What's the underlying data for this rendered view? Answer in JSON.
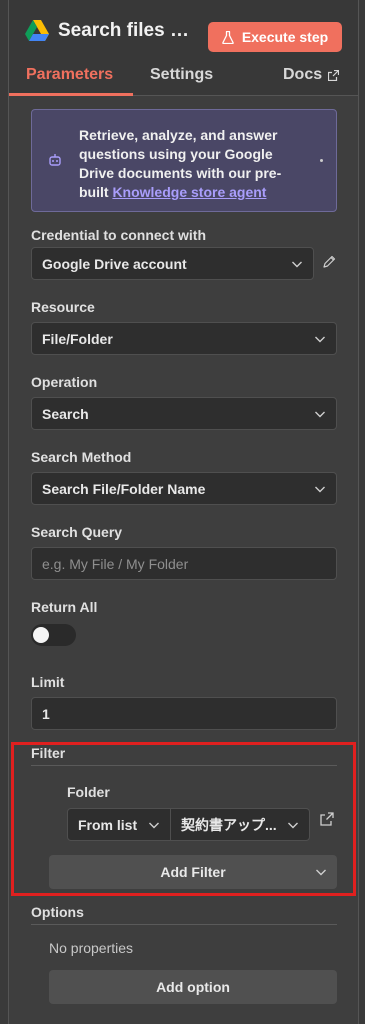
{
  "header": {
    "title": "Search files a...",
    "execute_label": "Execute step",
    "icon": "google-drive-icon"
  },
  "tabs": [
    {
      "label": "Parameters",
      "active": true
    },
    {
      "label": "Settings",
      "active": false
    },
    {
      "label": "Docs",
      "active": false
    }
  ],
  "callout": {
    "text": "Retrieve, analyze, and answer questions using your Google Drive documents with our pre-built",
    "link": "Knowledge store agent"
  },
  "fields": {
    "credential": {
      "label": "Credential to connect with",
      "value": "Google Drive account"
    },
    "resource": {
      "label": "Resource",
      "value": "File/Folder"
    },
    "operation": {
      "label": "Operation",
      "value": "Search"
    },
    "search_method": {
      "label": "Search Method",
      "value": "Search File/Folder Name"
    },
    "search_query": {
      "label": "Search Query",
      "placeholder": "e.g. My File / My Folder"
    },
    "return_all": {
      "label": "Return All",
      "enabled": false
    },
    "limit": {
      "label": "Limit",
      "value": "1"
    }
  },
  "filter": {
    "title": "Filter",
    "folder_label": "Folder",
    "mode": "From list",
    "folder_value": "契約書アップ...",
    "add_filter_label": "Add Filter"
  },
  "options": {
    "title": "Options",
    "empty_text": "No properties",
    "add_label": "Add option"
  },
  "colors": {
    "accent": "#f0705e",
    "callout_link": "#a99dfb",
    "highlight_box": "#e0201f"
  }
}
